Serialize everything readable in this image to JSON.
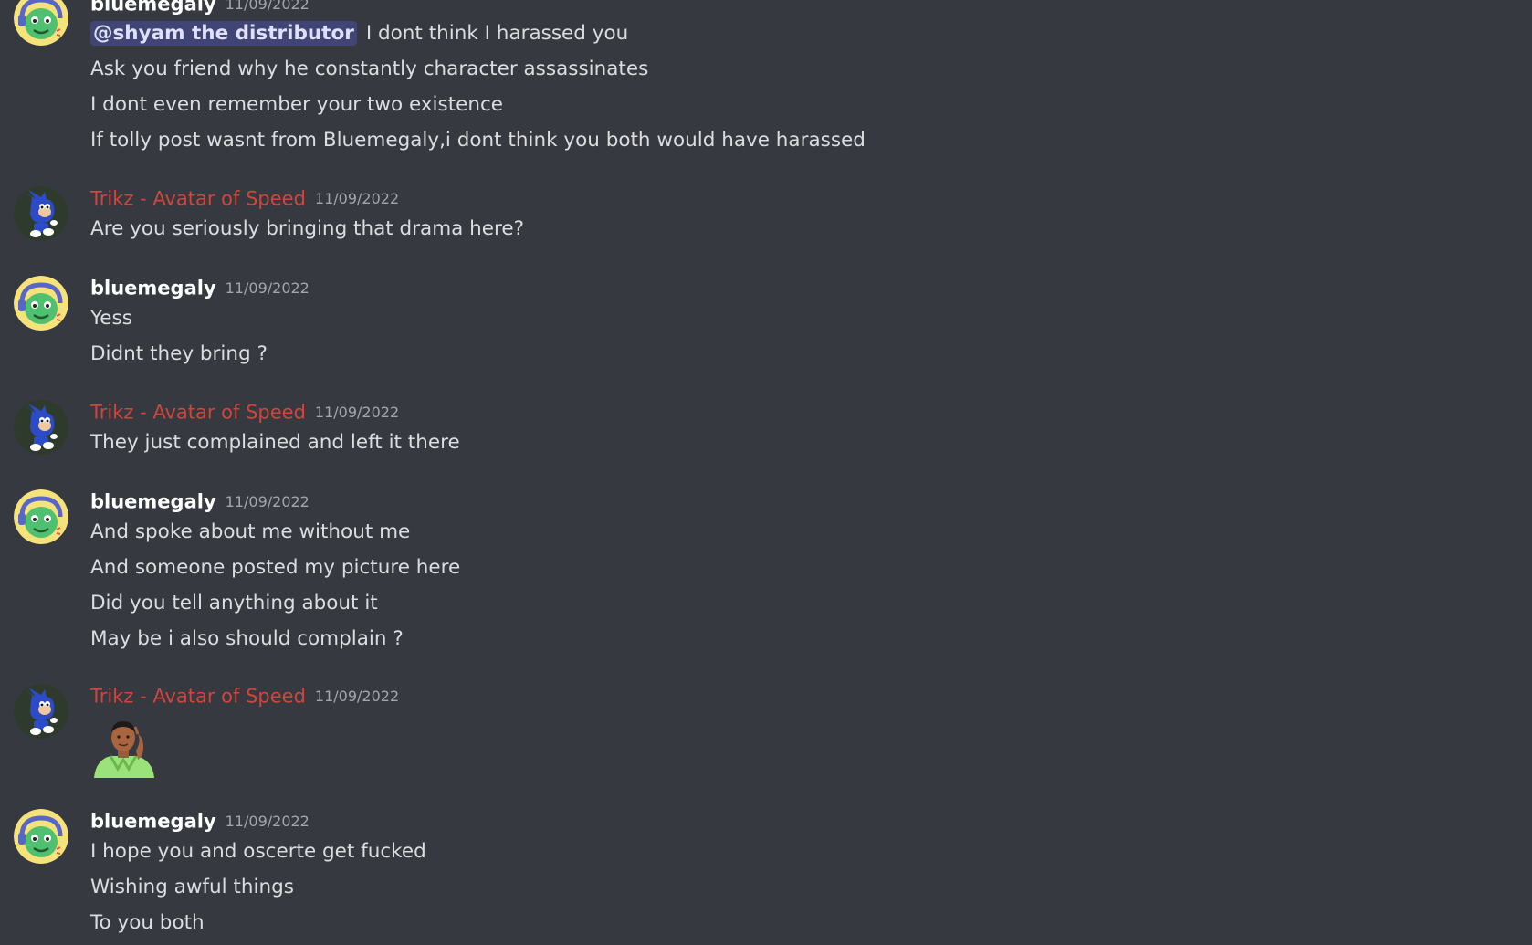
{
  "messages": [
    {
      "author": "bluemegaly",
      "timestamp": "11/09/2022",
      "mention": "@shyam the distributor",
      "lines": [
        "I dont think I harassed you",
        "Ask you friend why he constantly character assassinates",
        "I dont even remember your two existence",
        "If tolly post wasnt from Bluemegaly,i dont think you both would have harassed"
      ]
    },
    {
      "author": "Trikz - Avatar of Speed",
      "timestamp": "11/09/2022",
      "lines": [
        "Are you seriously bringing that drama here?"
      ]
    },
    {
      "author": "bluemegaly",
      "timestamp": "11/09/2022",
      "lines": [
        "Yess",
        "Didnt they bring ?"
      ]
    },
    {
      "author": "Trikz - Avatar of Speed",
      "timestamp": "11/09/2022",
      "lines": [
        "They just complained and left it there"
      ]
    },
    {
      "author": "bluemegaly",
      "timestamp": "11/09/2022",
      "lines": [
        "And spoke about me without me",
        "And someone posted my picture here",
        "Did you tell anything about it",
        "May be i also should complain ?"
      ]
    },
    {
      "author": "Trikz - Avatar of Speed",
      "timestamp": "11/09/2022",
      "lines": []
    },
    {
      "author": "bluemegaly",
      "timestamp": "11/09/2022",
      "lines": [
        "I hope you and oscerte get fucked",
        "Wishing awful things",
        "To you both"
      ]
    }
  ]
}
